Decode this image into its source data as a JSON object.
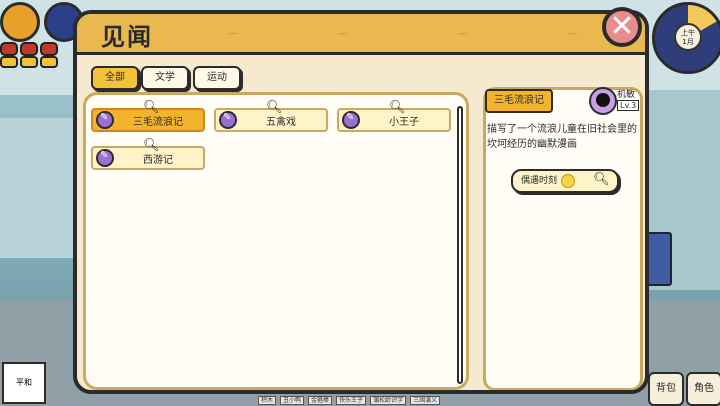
{
  "window": {
    "title": "见闻"
  },
  "filters": [
    {
      "label": "全部",
      "active": true
    },
    {
      "label": "文学",
      "active": false
    },
    {
      "label": "运动",
      "active": false
    }
  ],
  "items": [
    {
      "label": "三毛流浪记",
      "selected": true
    },
    {
      "label": "五禽戏",
      "selected": false
    },
    {
      "label": "小王子",
      "selected": false
    },
    {
      "label": "西游记",
      "selected": false
    }
  ],
  "detail": {
    "title": "三毛流浪记",
    "stat_name": "机敏",
    "stat_level": "Lv.3",
    "description": "描写了一个流浪儿童在旧社会里的坎坷经历的幽默漫画",
    "encounter_label": "偶遇时刻"
  },
  "clock": {
    "period": "上午",
    "date": "1月"
  },
  "bottom": {
    "bag": "背包",
    "role": "角色",
    "mood": "平和"
  },
  "strip_items": [
    "积木",
    "丑小鸭",
    "金箍棒",
    "快乐王子",
    "蒲松龄识字",
    "三国演义"
  ],
  "colors": {
    "header": "#e9b84f",
    "selected": "#f3b42d",
    "panel": "#f5ead0"
  }
}
